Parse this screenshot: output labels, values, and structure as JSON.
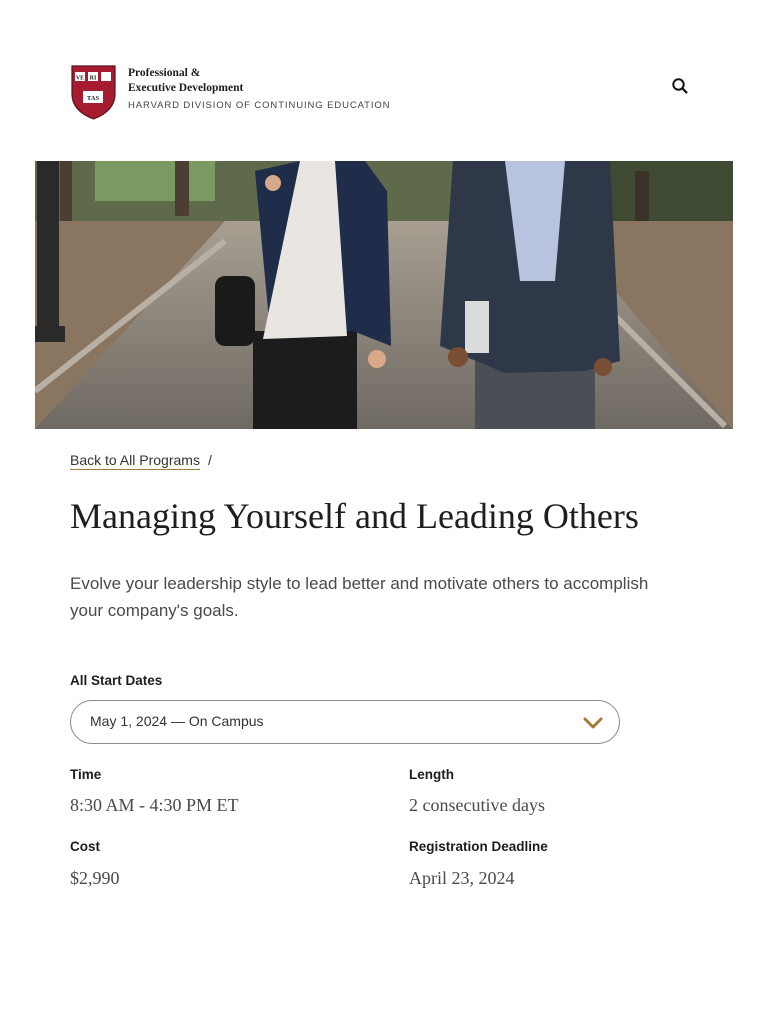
{
  "header": {
    "brand_line1": "Professional &",
    "brand_line2": "Executive Development",
    "brand_line3": "HARVARD DIVISION OF CONTINUING EDUCATION",
    "shield_text": [
      "VE",
      "RI",
      "TAS"
    ],
    "brand_color": "#a51c30"
  },
  "breadcrumb": {
    "back_label": "Back to All Programs",
    "separator": "/"
  },
  "program": {
    "title": "Managing Yourself and Leading Others",
    "description": "Evolve your leadership style to lead better and motivate others to accomplish your company's goals."
  },
  "dates": {
    "label": "All Start Dates",
    "selected": "May 1, 2024 — On Campus"
  },
  "details": {
    "time_label": "Time",
    "time_value": "8:30 AM - 4:30 PM ET",
    "length_label": "Length",
    "length_value": "2 consecutive days",
    "cost_label": "Cost",
    "cost_value": "$2,990",
    "deadline_label": "Registration Deadline",
    "deadline_value": "April 23, 2024"
  },
  "icons": {
    "search": "search-icon",
    "chevron": "chevron-down-icon"
  },
  "colors": {
    "accent": "#a37d37",
    "crimson": "#a51c30"
  }
}
